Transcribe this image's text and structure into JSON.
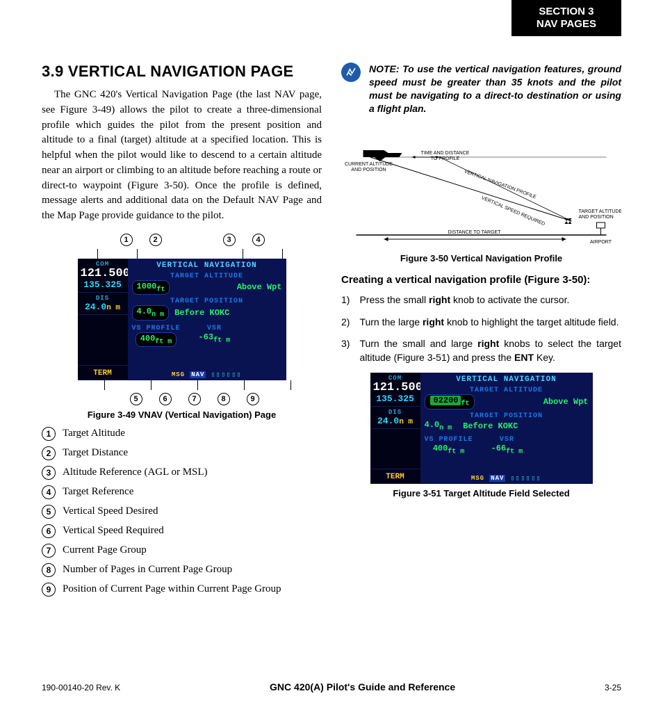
{
  "section_tab": {
    "line1": "SECTION 3",
    "line2": "NAV PAGES"
  },
  "heading": "3.9  VERTICAL NAVIGATION PAGE",
  "intro": "The GNC 420's Vertical Navigation Page (the last NAV page, see Figure 3-49) allows the pilot to create a three-dimensional profile which guides the pilot from the present position and altitude to a final (target) altitude at a specified location.  This is helpful when the pilot would like to descend to a certain altitude near an airport or climbing to an altitude before reaching a route or direct-to waypoint (Figure 3-50).  Once the profile is defined, message alerts and additional data on the Default NAV Page and the Map Page provide guidance to the pilot.",
  "fig349": {
    "top_callouts": [
      "1",
      "2",
      "3",
      "4"
    ],
    "bottom_callouts": [
      "5",
      "6",
      "7",
      "8",
      "9"
    ],
    "caption": "Figure 3-49  VNAV (Vertical Navigation) Page",
    "gps": {
      "com_lbl": "COM",
      "com_active": "121.500",
      "com_standby": "135.325",
      "dis_lbl": "DIS",
      "dis": "24.0",
      "dis_unit": "n m",
      "term": "TERM",
      "title": "VERTICAL NAVIGATION",
      "ta_lbl": "TARGET ALTITUDE",
      "ta_val": "1000",
      "ta_unit": "ft",
      "ta_ref": "Above Wpt",
      "tp_lbl": "TARGET POSITION",
      "tp_dist": "4.0",
      "tp_dist_unit": "n m",
      "tp_rel": "Before KOKC",
      "vsp_lbl": "VS PROFILE",
      "vsp_val": "400",
      "vsp_unit": "ft m",
      "vsr_lbl": "VSR",
      "vsr_val": "-63",
      "vsr_unit": "ft m",
      "msg": "MSG",
      "nav": "NAV",
      "boxes": "▯▯▯▯▯▯"
    }
  },
  "legend": [
    {
      "n": "1",
      "t": "Target Altitude"
    },
    {
      "n": "2",
      "t": "Target Distance"
    },
    {
      "n": "3",
      "t": "Altitude Reference (AGL or MSL)"
    },
    {
      "n": "4",
      "t": "Target Reference"
    },
    {
      "n": "5",
      "t": "Vertical Speed Desired"
    },
    {
      "n": "6",
      "t": "Vertical Speed Required"
    },
    {
      "n": "7",
      "t": "Current Page Group"
    },
    {
      "n": "8",
      "t": "Number of Pages in Current Page Group"
    },
    {
      "n": "9",
      "t": "Position of Current Page within Current Page Group"
    }
  ],
  "note": "NOTE:  To use the vertical navigation features, ground speed must be greater than 35 knots and the pilot must be navigating to a direct-to destination or using a flight plan.",
  "diagram": {
    "labels": {
      "vnp": "VERTICAL NAVIGATION PROFILE",
      "tdp1": "TIME AND DISTANCE",
      "tdp2": "TO PROFILE",
      "cap1": "CURRENT ALTITUDE",
      "cap2": "AND POSITION",
      "vsr": "VERTICAL SPEED REQUIRED",
      "tap1": "TARGET ALTITUDE",
      "tap2": "AND POSITION",
      "dtt": "DISTANCE TO TARGET",
      "airport": "AIRPORT"
    },
    "caption": "Figure 3-50  Vertical Navigation Profile"
  },
  "subhead": "Creating a vertical navigation profile (Figure 3-50):",
  "steps": [
    {
      "n": "1)",
      "pre": "Press the small ",
      "b": "right",
      "post": " knob to activate the cursor."
    },
    {
      "n": "2)",
      "pre": "Turn the large ",
      "b": "right",
      "post": " knob to highlight the target altitude field."
    },
    {
      "n": "3)",
      "pre": "Turn the small and large ",
      "b": "right",
      "mid": " knobs to select the target altitude (Figure 3-51) and press the ",
      "b2": "ENT",
      "post": " Key."
    }
  ],
  "fig351": {
    "caption": "Figure 3-51  Target Altitude Field Selected",
    "gps": {
      "com_lbl": "COM",
      "com_active": "121.500",
      "com_standby": "135.325",
      "dis_lbl": "DIS",
      "dis": "24.0",
      "dis_unit": "n m",
      "term": "TERM",
      "title": "VERTICAL NAVIGATION",
      "ta_lbl": "TARGET ALTITUDE",
      "ta_val_hi": "02200",
      "ta_unit": "ft",
      "ta_ref": "Above Wpt",
      "tp_lbl": "TARGET POSITION",
      "tp_dist": "4.0",
      "tp_dist_unit": "n m",
      "tp_rel": "Before KOKC",
      "vsp_lbl": "VS PROFILE",
      "vsp_val": "400",
      "vsp_unit": "ft m",
      "vsr_lbl": "VSR",
      "vsr_val": "-66",
      "vsr_unit": "ft m",
      "msg": "MSG",
      "nav": "NAV",
      "boxes": "▯▯▯▯▯▯"
    }
  },
  "footer": {
    "left": "190-00140-20  Rev. K",
    "mid": "GNC 420(A) Pilot's Guide and Reference",
    "right": "3-25"
  }
}
